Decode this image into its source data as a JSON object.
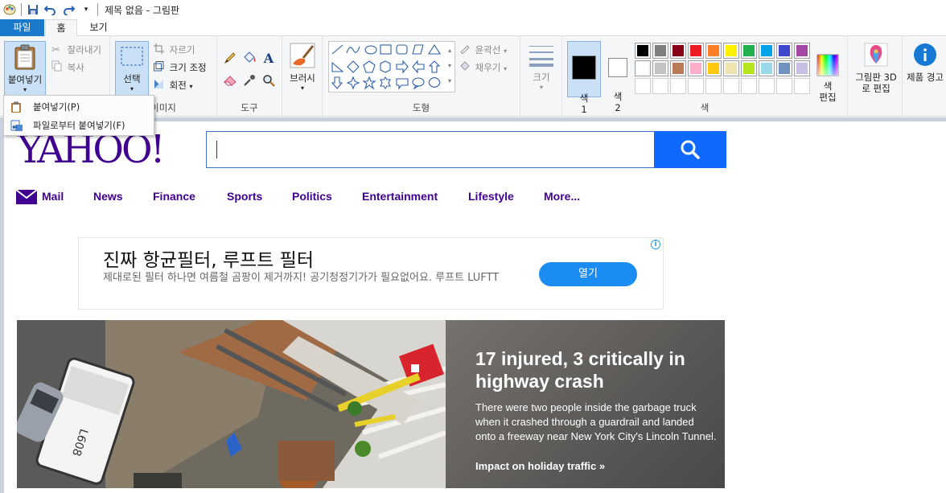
{
  "window": {
    "title": "제목 없음 - 그림판"
  },
  "tabs": [
    {
      "label": "파일"
    },
    {
      "label": "홈"
    },
    {
      "label": "보기"
    }
  ],
  "ribbon": {
    "clipboard": {
      "paste": "붙여넣기",
      "cut": "잘라내기",
      "copy": "복사"
    },
    "image": {
      "label": "이미지",
      "select": "선택",
      "crop": "자르기",
      "resize": "크기 조정",
      "rotate": "회전"
    },
    "tools": {
      "label": "도구"
    },
    "brushes": {
      "label": "브러시"
    },
    "shapes": {
      "label": "도형",
      "outline": "윤곽선",
      "fill": "채우기"
    },
    "size": {
      "label": "크기"
    },
    "colors": {
      "label": "색",
      "color1": "색\n1",
      "color2": "색\n2",
      "edit": "색\n편집",
      "row1": [
        "#000000",
        "#7f7f7f",
        "#880015",
        "#ed1c24",
        "#ff7f27",
        "#fff200",
        "#22b14c",
        "#00a2e8",
        "#3f48cc",
        "#a349a4"
      ],
      "row2": [
        "#ffffff",
        "#c3c3c3",
        "#b97a57",
        "#ffaec9",
        "#ffc90e",
        "#efe4b0",
        "#b5e61d",
        "#99d9ea",
        "#7092be",
        "#c8bfe7"
      ]
    },
    "paint3d": {
      "label": "그림판 3D로 편집"
    },
    "product_alert": {
      "label": "제품 경고"
    }
  },
  "paste_menu": {
    "items": [
      {
        "label": "붙여넣기(P)"
      },
      {
        "label": "파일로부터 붙여넣기(F)"
      }
    ]
  },
  "yahoo": {
    "logo": "YAHOO!",
    "search": {
      "value": ""
    },
    "nav": [
      "Mail",
      "News",
      "Finance",
      "Sports",
      "Politics",
      "Entertainment",
      "Lifestyle",
      "More..."
    ],
    "ad": {
      "title": "진짜 항균필터, 루프트 필터",
      "description": "제대로된 필터 하나면 여름철 곰팡이 제거까지! 공기청정기가가 필요없어요. 루프트 LUFTT",
      "button": "열기"
    },
    "hero": {
      "headline": "17 injured, 3 critically in highway crash",
      "body": "There were two people inside the garbage truck when it crashed through a guardrail and landed onto a freeway near New York City's Lincoln Tunnel.",
      "link": "Impact on holiday traffic »"
    }
  }
}
